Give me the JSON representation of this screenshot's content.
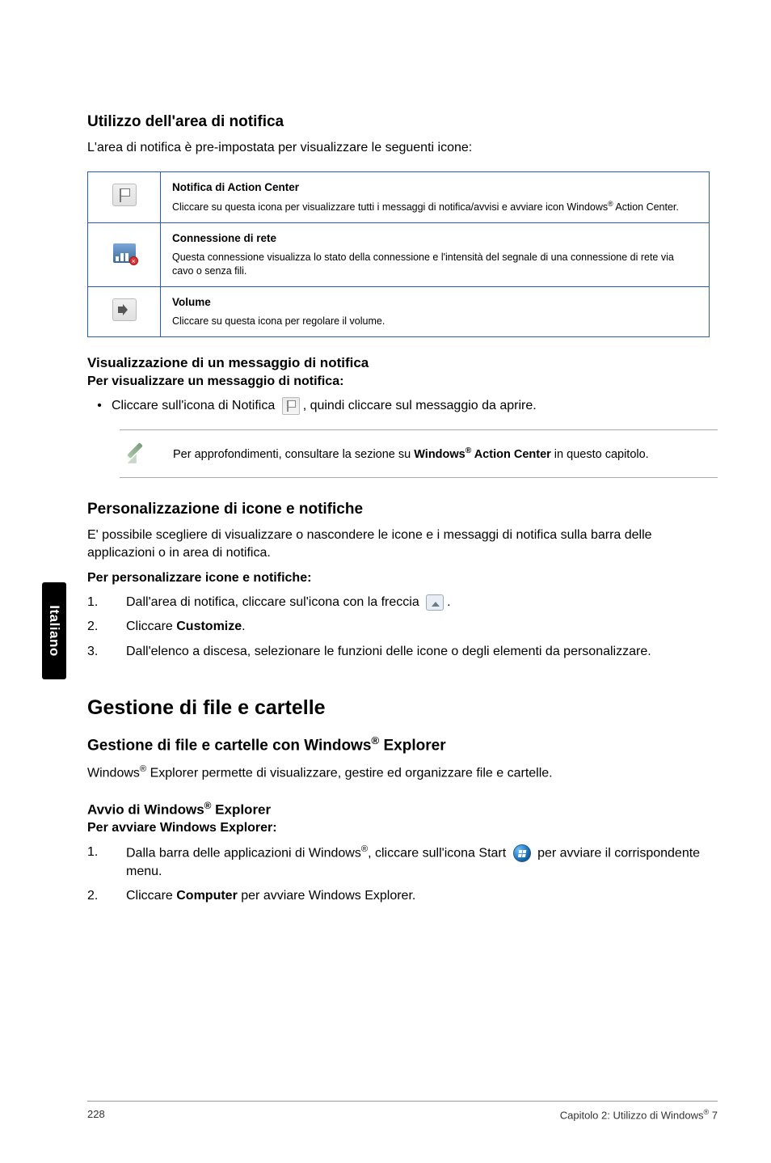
{
  "sideTab": "Italiano",
  "s1": {
    "title": "Utilizzo dell'area di notifica",
    "intro": "L'area di notifica è pre-impostata per visualizzare le seguenti icone:",
    "rows": [
      {
        "iconName": "action-center-tray-icon",
        "title": "Notifica di Action Center",
        "text_a": "Cliccare su questa icona per visualizzare tutti i messaggi di notifica/avvisi e avviare icon Windows",
        "text_b": " Action Center."
      },
      {
        "iconName": "network-tray-icon",
        "title": "Connessione di rete",
        "text_a": "Questa connessione visualizza lo stato della connessione e l'intensità del segnale di una connessione di rete via cavo o senza fili.",
        "text_b": ""
      },
      {
        "iconName": "volume-tray-icon",
        "title": "Volume",
        "text_a": "Cliccare su questa icona per regolare il volume.",
        "text_b": ""
      }
    ]
  },
  "s2": {
    "title": "Visualizzazione di un messaggio di notifica",
    "stepTitle": "Per visualizzare un messaggio di notifica:",
    "bullet_a": "Cliccare sull'icona di Notifica ",
    "bullet_b": ", quindi cliccare sul messaggio da aprire.",
    "note_a": "Per approfondimenti, consultare la sezione su ",
    "note_bold_a": "Windows",
    "note_bold_b": " Action Center",
    "note_c": " in questo capitolo."
  },
  "s3": {
    "title": "Personalizzazione di icone e notifiche",
    "intro": "E' possibile scegliere di visualizzare o nascondere le icone e i messaggi di notifica sulla barra delle applicazioni o in area di notifica.",
    "stepTitle": "Per personalizzare icone e notifiche:",
    "steps": {
      "n1": "1.",
      "t1_a": "Dall'area di notifica, cliccare sul'icona con la freccia ",
      "t1_b": ".",
      "n2": "2.",
      "t2_a": "Cliccare ",
      "t2_bold": "Customize",
      "t2_b": ".",
      "n3": "3.",
      "t3": "Dall'elenco a discesa, selezionare le funzioni delle icone o degli elementi da personalizzare."
    }
  },
  "s4": {
    "title": "Gestione di file e cartelle",
    "sub1_a": "Gestione di file e cartelle con Windows",
    "sub1_b": " Explorer",
    "intro_a": "Windows",
    "intro_b": " Explorer permette di visualizzare, gestire ed organizzare file e cartelle.",
    "sub2_a": "Avvio di Windows",
    "sub2_b": " Explorer",
    "stepTitle": "Per avviare Windows Explorer:",
    "steps": {
      "n1": "1.",
      "t1_a": "Dalla barra delle applicazioni di Windows",
      "t1_b": ", cliccare sull'icona Start ",
      "t1_c": " per avviare il corrispondente menu.",
      "n2": "2.",
      "t2_a": "Cliccare ",
      "t2_bold": "Computer",
      "t2_b": " per avviare Windows Explorer."
    }
  },
  "footer": {
    "page": "228",
    "chapter_a": "Capitolo 2: Utilizzo di Windows",
    "chapter_b": " 7"
  }
}
